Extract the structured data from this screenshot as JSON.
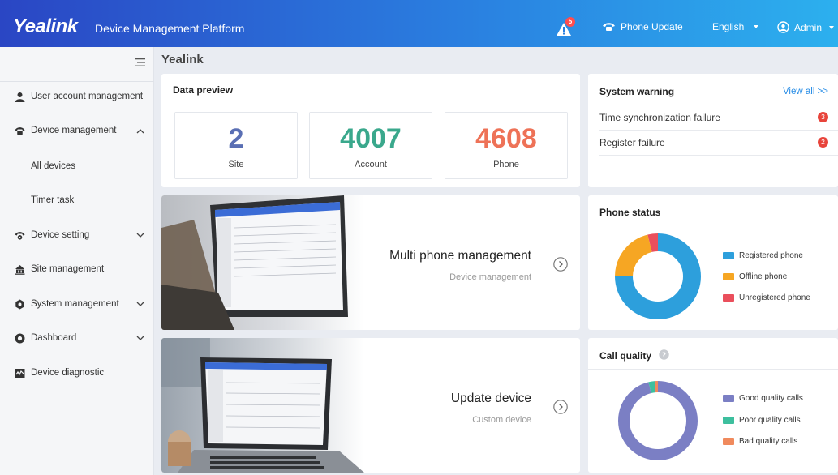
{
  "header": {
    "logo": "Yealink",
    "platform": "Device Management Platform",
    "alert_count": "5",
    "phone_update": "Phone Update",
    "language": "English",
    "user": "Admin"
  },
  "sidebar": {
    "items": [
      {
        "label": "User account management",
        "icon": "user-icon"
      },
      {
        "label": "Device management",
        "icon": "phone-icon"
      },
      {
        "label": "All devices"
      },
      {
        "label": "Timer task"
      },
      {
        "label": "Device setting",
        "icon": "phone-settings-icon"
      },
      {
        "label": "Site management",
        "icon": "building-icon"
      },
      {
        "label": "System management",
        "icon": "gear-icon"
      },
      {
        "label": "Dashboard",
        "icon": "dashboard-icon"
      },
      {
        "label": "Device diagnostic",
        "icon": "diagnostic-icon"
      }
    ]
  },
  "breadcrumb": "Yealink",
  "data_preview": {
    "title": "Data preview",
    "stats": [
      {
        "value": "2",
        "label": "Site",
        "color": "#5a6fb4"
      },
      {
        "value": "4007",
        "label": "Account",
        "color": "#3aa88c"
      },
      {
        "value": "4608",
        "label": "Phone",
        "color": "#ee7257"
      }
    ]
  },
  "system_warning": {
    "title": "System warning",
    "view_all": "View all >>",
    "items": [
      {
        "label": "Time synchronization failure",
        "count": "3"
      },
      {
        "label": "Register failure",
        "count": "2"
      }
    ]
  },
  "banners": [
    {
      "title": "Multi phone management",
      "subtitle": "Device management"
    },
    {
      "title": "Update device",
      "subtitle": "Custom device"
    }
  ],
  "phone_status": {
    "title": "Phone status",
    "legend": [
      {
        "label": "Registered phone",
        "color": "#2d9fdc"
      },
      {
        "label": "Offline phone",
        "color": "#f6a623"
      },
      {
        "label": "Unregistered phone",
        "color": "#ea4f5c"
      }
    ],
    "chart_data": {
      "type": "pie",
      "categories": [
        "Registered phone",
        "Offline phone",
        "Unregistered phone"
      ],
      "values": [
        75,
        21,
        4
      ]
    }
  },
  "call_quality": {
    "title": "Call quality",
    "legend": [
      {
        "label": "Good quality calls",
        "color": "#7b7fc4"
      },
      {
        "label": "Poor quality calls",
        "color": "#3dbf9e"
      },
      {
        "label": "Bad quality calls",
        "color": "#f08a5d"
      }
    ],
    "chart_data": {
      "type": "pie",
      "categories": [
        "Good quality calls",
        "Poor quality calls",
        "Bad quality calls"
      ],
      "values": [
        96,
        2.5,
        1.5
      ]
    }
  }
}
